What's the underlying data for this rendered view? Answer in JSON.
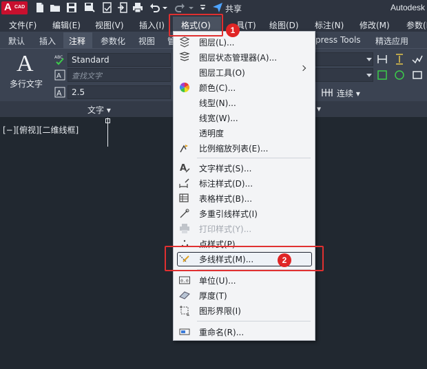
{
  "titlebar": {
    "app_logo_big": "A",
    "app_logo_small": "CAD",
    "share_label": "共享",
    "app_title": "Autodesk"
  },
  "menubar": {
    "items": [
      {
        "label": "文件(F)"
      },
      {
        "label": "编辑(E)"
      },
      {
        "label": "视图(V)"
      },
      {
        "label": "插入(I)"
      },
      {
        "label": "格式(O)"
      },
      {
        "label": "工具(T)"
      },
      {
        "label": "绘图(D)"
      },
      {
        "label": "标注(N)"
      },
      {
        "label": "修改(M)"
      },
      {
        "label": "参数(P)"
      }
    ],
    "visible_partial": "具(T)"
  },
  "ribbon_tabs": {
    "items": [
      "默认",
      "插入",
      "注释",
      "参数化",
      "视图",
      "管",
      "press Tools",
      "精选应用"
    ],
    "active": "注释"
  },
  "ribbon": {
    "multitext_glyph": "A",
    "multitext_label": "多行文字",
    "text_style": "Standard",
    "find_text_placeholder": "查找文字",
    "text_height": "2.5",
    "panel_label": "文字 ▾",
    "annotation_panel_label": "▾",
    "continue_label": "连续 ▾"
  },
  "drawing": {
    "viewport_label": "[−][俯视][二维线框]"
  },
  "dropdown": {
    "items": [
      {
        "label": "图层(L)...",
        "icon": "layer-icon",
        "enabled": true
      },
      {
        "label": "图层状态管理器(A)...",
        "icon": "layer-state-icon",
        "enabled": true
      },
      {
        "label": "图层工具(O)",
        "icon": "",
        "enabled": true,
        "submenu": true
      },
      {
        "label": "颜色(C)...",
        "icon": "color-wheel-icon",
        "enabled": true
      },
      {
        "label": "线型(N)...",
        "icon": "",
        "enabled": true
      },
      {
        "label": "线宽(W)...",
        "icon": "",
        "enabled": true
      },
      {
        "label": "透明度",
        "icon": "",
        "enabled": true
      },
      {
        "label": "比例缩放列表(E)...",
        "icon": "scale-list-icon",
        "enabled": true
      },
      {
        "label": "文字样式(S)...",
        "icon": "text-style-icon",
        "enabled": true
      },
      {
        "label": "标注样式(D)...",
        "icon": "dim-style-icon",
        "enabled": true
      },
      {
        "label": "表格样式(B)...",
        "icon": "table-style-icon",
        "enabled": true
      },
      {
        "label": "多重引线样式(I)",
        "icon": "mleader-style-icon",
        "enabled": true
      },
      {
        "label": "打印样式(Y)...",
        "icon": "plot-style-icon",
        "enabled": false
      },
      {
        "label": "点样式(P)...",
        "icon": "point-style-icon",
        "enabled": true
      },
      {
        "label": "多线样式(M)...",
        "icon": "mline-style-icon",
        "enabled": true,
        "highlighted": true
      },
      {
        "label": "单位(U)...",
        "icon": "units-icon",
        "enabled": true
      },
      {
        "label": "厚度(T)",
        "icon": "thickness-icon",
        "enabled": true
      },
      {
        "label": "图形界限(I)",
        "icon": "limits-icon",
        "enabled": true
      },
      {
        "label": "重命名(R)...",
        "icon": "rename-icon",
        "enabled": true
      }
    ]
  },
  "annotations": {
    "badge_1": "1",
    "badge_2": "2",
    "highlight_color": "#e03030"
  }
}
